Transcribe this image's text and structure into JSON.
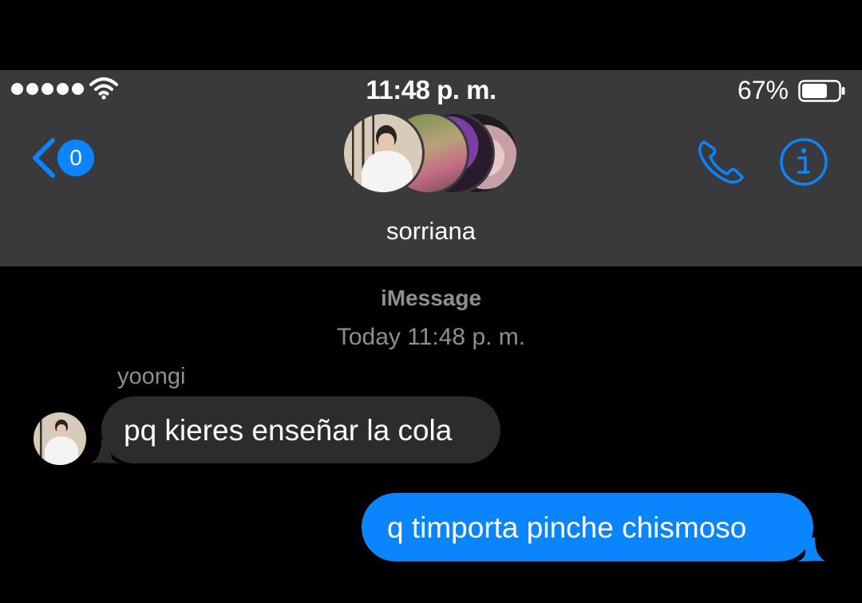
{
  "status_bar": {
    "time": "11:48 p. m.",
    "battery_percent": "67%",
    "battery_level": 0.67,
    "signal_bars": 5
  },
  "nav": {
    "back_badge": "0",
    "chat_name": "sorriana"
  },
  "conversation": {
    "service_label": "iMessage",
    "timestamp": "Today 11:48 p. m.",
    "messages": [
      {
        "direction": "incoming",
        "sender": "yoongi",
        "text": "pq kieres enseñar la cola"
      },
      {
        "direction": "outgoing",
        "text": "q timporta pinche chismoso"
      }
    ]
  },
  "colors": {
    "accent": "#0a84ff",
    "header_bg": "#3a3a3c",
    "incoming_bubble": "#2c2c2e",
    "outgoing_bubble": "#0a84ff",
    "secondary_text": "#8e8e93"
  },
  "icons": {
    "back": "chevron-left-icon",
    "wifi": "wifi-icon",
    "battery": "battery-icon",
    "phone": "phone-icon",
    "info": "info-icon"
  }
}
